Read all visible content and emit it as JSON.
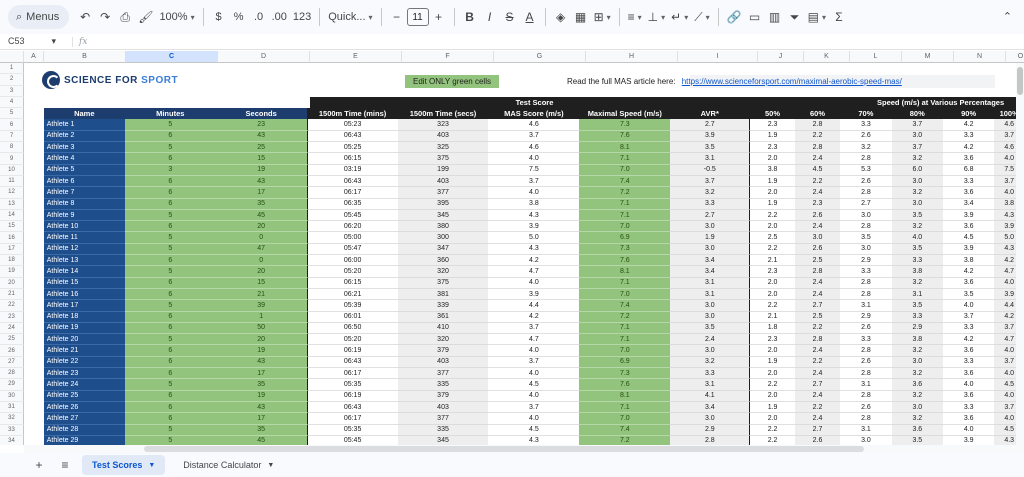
{
  "toolbar": {
    "menus_label": "Menus",
    "zoom": "100%",
    "currency": "$",
    "percent": "%",
    "dec_less": ".0",
    "dec_more": ".00",
    "format_123": "123",
    "font": "Quick...",
    "font_size": "11",
    "bold": "B",
    "italic": "I",
    "strike": "S",
    "text_color": "A",
    "sigma": "Σ"
  },
  "formula_bar": {
    "cell_ref": "C53",
    "fx": "fx"
  },
  "columns": [
    "A",
    "B",
    "C",
    "D",
    "E",
    "F",
    "G",
    "H",
    "I",
    "J",
    "K",
    "L",
    "M",
    "N",
    "O"
  ],
  "selected_column": "C",
  "rows": [
    "1",
    "2",
    "3",
    "4",
    "5",
    "6",
    "7",
    "8",
    "9",
    "10",
    "11",
    "12",
    "13",
    "14",
    "15",
    "16",
    "17",
    "18",
    "19",
    "20",
    "21",
    "22",
    "23",
    "24",
    "25",
    "26",
    "27",
    "28",
    "29",
    "30",
    "31",
    "32",
    "33",
    "34"
  ],
  "logo": {
    "part1": "SCIENCE FOR ",
    "part2": "SPORT"
  },
  "edit_note": "Edit ONLY green cells",
  "article": {
    "label": "Read the full MAS article here:",
    "link": "https://www.scienceforsport.com/maximal-aerobic-speed-mas/"
  },
  "group_headers": {
    "test_score": "Test Score",
    "speed": "Speed (m/s) at Various Percentages"
  },
  "headers": [
    "Name",
    "Minutes",
    "Seconds",
    "1500m Time (mins)",
    "1500m Time (secs)",
    "MAS Score (m/s)",
    "Maximal Speed (m/s)",
    "AVR*",
    "50%",
    "60%",
    "70%",
    "80%",
    "90%",
    "100%"
  ],
  "data": [
    [
      "Athlete 1",
      "5",
      "23",
      "05:23",
      "323",
      "4.6",
      "7.3",
      "2.7",
      "2.3",
      "2.8",
      "3.3",
      "3.7",
      "4.2",
      "4.6"
    ],
    [
      "Athlete 2",
      "6",
      "43",
      "06:43",
      "403",
      "3.7",
      "7.6",
      "3.9",
      "1.9",
      "2.2",
      "2.6",
      "3.0",
      "3.3",
      "3.7"
    ],
    [
      "Athlete 3",
      "5",
      "25",
      "05:25",
      "325",
      "4.6",
      "8.1",
      "3.5",
      "2.3",
      "2.8",
      "3.2",
      "3.7",
      "4.2",
      "4.6"
    ],
    [
      "Athlete 4",
      "6",
      "15",
      "06:15",
      "375",
      "4.0",
      "7.1",
      "3.1",
      "2.0",
      "2.4",
      "2.8",
      "3.2",
      "3.6",
      "4.0"
    ],
    [
      "Athlete 5",
      "3",
      "19",
      "03:19",
      "199",
      "7.5",
      "7.0",
      "-0.5",
      "3.8",
      "4.5",
      "5.3",
      "6.0",
      "6.8",
      "7.5"
    ],
    [
      "Athlete 6",
      "6",
      "43",
      "06:43",
      "403",
      "3.7",
      "7.4",
      "3.7",
      "1.9",
      "2.2",
      "2.6",
      "3.0",
      "3.3",
      "3.7"
    ],
    [
      "Athlete 7",
      "6",
      "17",
      "06:17",
      "377",
      "4.0",
      "7.2",
      "3.2",
      "2.0",
      "2.4",
      "2.8",
      "3.2",
      "3.6",
      "4.0"
    ],
    [
      "Athlete 8",
      "6",
      "35",
      "06:35",
      "395",
      "3.8",
      "7.1",
      "3.3",
      "1.9",
      "2.3",
      "2.7",
      "3.0",
      "3.4",
      "3.8"
    ],
    [
      "Athlete 9",
      "5",
      "45",
      "05:45",
      "345",
      "4.3",
      "7.1",
      "2.7",
      "2.2",
      "2.6",
      "3.0",
      "3.5",
      "3.9",
      "4.3"
    ],
    [
      "Athlete 10",
      "6",
      "20",
      "06:20",
      "380",
      "3.9",
      "7.0",
      "3.0",
      "2.0",
      "2.4",
      "2.8",
      "3.2",
      "3.6",
      "3.9"
    ],
    [
      "Athlete 11",
      "5",
      "0",
      "05:00",
      "300",
      "5.0",
      "6.9",
      "1.9",
      "2.5",
      "3.0",
      "3.5",
      "4.0",
      "4.5",
      "5.0"
    ],
    [
      "Athlete 12",
      "5",
      "47",
      "05:47",
      "347",
      "4.3",
      "7.3",
      "3.0",
      "2.2",
      "2.6",
      "3.0",
      "3.5",
      "3.9",
      "4.3"
    ],
    [
      "Athlete 13",
      "6",
      "0",
      "06:00",
      "360",
      "4.2",
      "7.6",
      "3.4",
      "2.1",
      "2.5",
      "2.9",
      "3.3",
      "3.8",
      "4.2"
    ],
    [
      "Athlete 14",
      "5",
      "20",
      "05:20",
      "320",
      "4.7",
      "8.1",
      "3.4",
      "2.3",
      "2.8",
      "3.3",
      "3.8",
      "4.2",
      "4.7"
    ],
    [
      "Athlete 15",
      "6",
      "15",
      "06:15",
      "375",
      "4.0",
      "7.1",
      "3.1",
      "2.0",
      "2.4",
      "2.8",
      "3.2",
      "3.6",
      "4.0"
    ],
    [
      "Athlete 16",
      "6",
      "21",
      "06:21",
      "381",
      "3.9",
      "7.0",
      "3.1",
      "2.0",
      "2.4",
      "2.8",
      "3.1",
      "3.5",
      "3.9"
    ],
    [
      "Athlete 17",
      "5",
      "39",
      "05:39",
      "339",
      "4.4",
      "7.4",
      "3.0",
      "2.2",
      "2.7",
      "3.1",
      "3.5",
      "4.0",
      "4.4"
    ],
    [
      "Athlete 18",
      "6",
      "1",
      "06:01",
      "361",
      "4.2",
      "7.2",
      "3.0",
      "2.1",
      "2.5",
      "2.9",
      "3.3",
      "3.7",
      "4.2"
    ],
    [
      "Athlete 19",
      "6",
      "50",
      "06:50",
      "410",
      "3.7",
      "7.1",
      "3.5",
      "1.8",
      "2.2",
      "2.6",
      "2.9",
      "3.3",
      "3.7"
    ],
    [
      "Athlete 20",
      "5",
      "20",
      "05:20",
      "320",
      "4.7",
      "7.1",
      "2.4",
      "2.3",
      "2.8",
      "3.3",
      "3.8",
      "4.2",
      "4.7"
    ],
    [
      "Athlete 21",
      "6",
      "19",
      "06:19",
      "379",
      "4.0",
      "7.0",
      "3.0",
      "2.0",
      "2.4",
      "2.8",
      "3.2",
      "3.6",
      "4.0"
    ],
    [
      "Athlete 22",
      "6",
      "43",
      "06:43",
      "403",
      "3.7",
      "6.9",
      "3.2",
      "1.9",
      "2.2",
      "2.6",
      "3.0",
      "3.3",
      "3.7"
    ],
    [
      "Athlete 23",
      "6",
      "17",
      "06:17",
      "377",
      "4.0",
      "7.3",
      "3.3",
      "2.0",
      "2.4",
      "2.8",
      "3.2",
      "3.6",
      "4.0"
    ],
    [
      "Athlete 24",
      "5",
      "35",
      "05:35",
      "335",
      "4.5",
      "7.6",
      "3.1",
      "2.2",
      "2.7",
      "3.1",
      "3.6",
      "4.0",
      "4.5"
    ],
    [
      "Athlete 25",
      "6",
      "19",
      "06:19",
      "379",
      "4.0",
      "8.1",
      "4.1",
      "2.0",
      "2.4",
      "2.8",
      "3.2",
      "3.6",
      "4.0"
    ],
    [
      "Athlete 26",
      "6",
      "43",
      "06:43",
      "403",
      "3.7",
      "7.1",
      "3.4",
      "1.9",
      "2.2",
      "2.6",
      "3.0",
      "3.3",
      "3.7"
    ],
    [
      "Athlete 27",
      "6",
      "17",
      "06:17",
      "377",
      "4.0",
      "7.0",
      "3.0",
      "2.0",
      "2.4",
      "2.8",
      "3.2",
      "3.6",
      "4.0"
    ],
    [
      "Athlete 28",
      "5",
      "35",
      "05:35",
      "335",
      "4.5",
      "7.4",
      "2.9",
      "2.2",
      "2.7",
      "3.1",
      "3.6",
      "4.0",
      "4.5"
    ],
    [
      "Athlete 29",
      "5",
      "45",
      "05:45",
      "345",
      "4.3",
      "7.2",
      "2.8",
      "2.2",
      "2.6",
      "3.0",
      "3.5",
      "3.9",
      "4.3"
    ]
  ],
  "sheet_tabs": [
    {
      "label": "Test Scores",
      "active": true
    },
    {
      "label": "Distance Calculator",
      "active": false
    }
  ]
}
